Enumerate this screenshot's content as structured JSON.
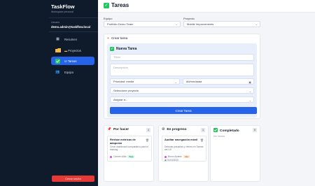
{
  "sidebar": {
    "brand": "TaskFlow",
    "brand_sub": "Workspace personal",
    "user_label": "Usuario",
    "user_email": "demo.admin@taskflow.local",
    "items": [
      {
        "label": "Resumen",
        "icon": "grid-icon"
      },
      {
        "label": "Proyectos",
        "icon": "folder-icon"
      },
      {
        "label": "Tareas",
        "icon": "check-icon"
      },
      {
        "label": "Equipo",
        "icon": "team-icon"
      }
    ],
    "logout": "Cerrar sesión"
  },
  "header": {
    "title": "Tareas"
  },
  "filters": {
    "equipo_label": "Equipo",
    "equipo_value": "Portfolio Demo Team",
    "proyecto_label": "Proyecto",
    "proyecto_value": "Mobile Improvements"
  },
  "create": {
    "header": "Crear tarea",
    "form_title": "Nueva Tarea",
    "title_placeholder": "Título",
    "desc_placeholder": "Descripción",
    "priority_value": "Prioridad: media",
    "date_value": "dd/mm/aaaa",
    "project_value": "Seleccione proyecto",
    "assign_value": "Asignar a...",
    "submit": "Crear Tarea"
  },
  "columns": [
    {
      "title": "Por hacer",
      "icon": "pin-icon",
      "count": "1",
      "tasks": [
        {
          "title": "Revisar métricas de adopción",
          "desc": "Crear dashboard comparativo para el backlog",
          "assignee": "Carmen Alba",
          "priority": "Baja",
          "date": ""
        }
      ]
    },
    {
      "title": "En progreso",
      "icon": "gear-icon",
      "count": "1",
      "tasks": [
        {
          "title": "Auditar navegación móvil",
          "desc": "Detectar pasadías y cierres en Tareas del UX",
          "assignee": "Bruno Alvarez",
          "priority": "Alta",
          "date": "01/03/2025"
        }
      ]
    },
    {
      "title": "Completado",
      "icon": "check-icon",
      "count": "0",
      "empty": "Sin tareas",
      "tasks": []
    }
  ],
  "colors": {
    "accent": "#2563eb",
    "sidebar": "#0f1a2b",
    "danger": "#e53935",
    "success": "#22c55e"
  }
}
